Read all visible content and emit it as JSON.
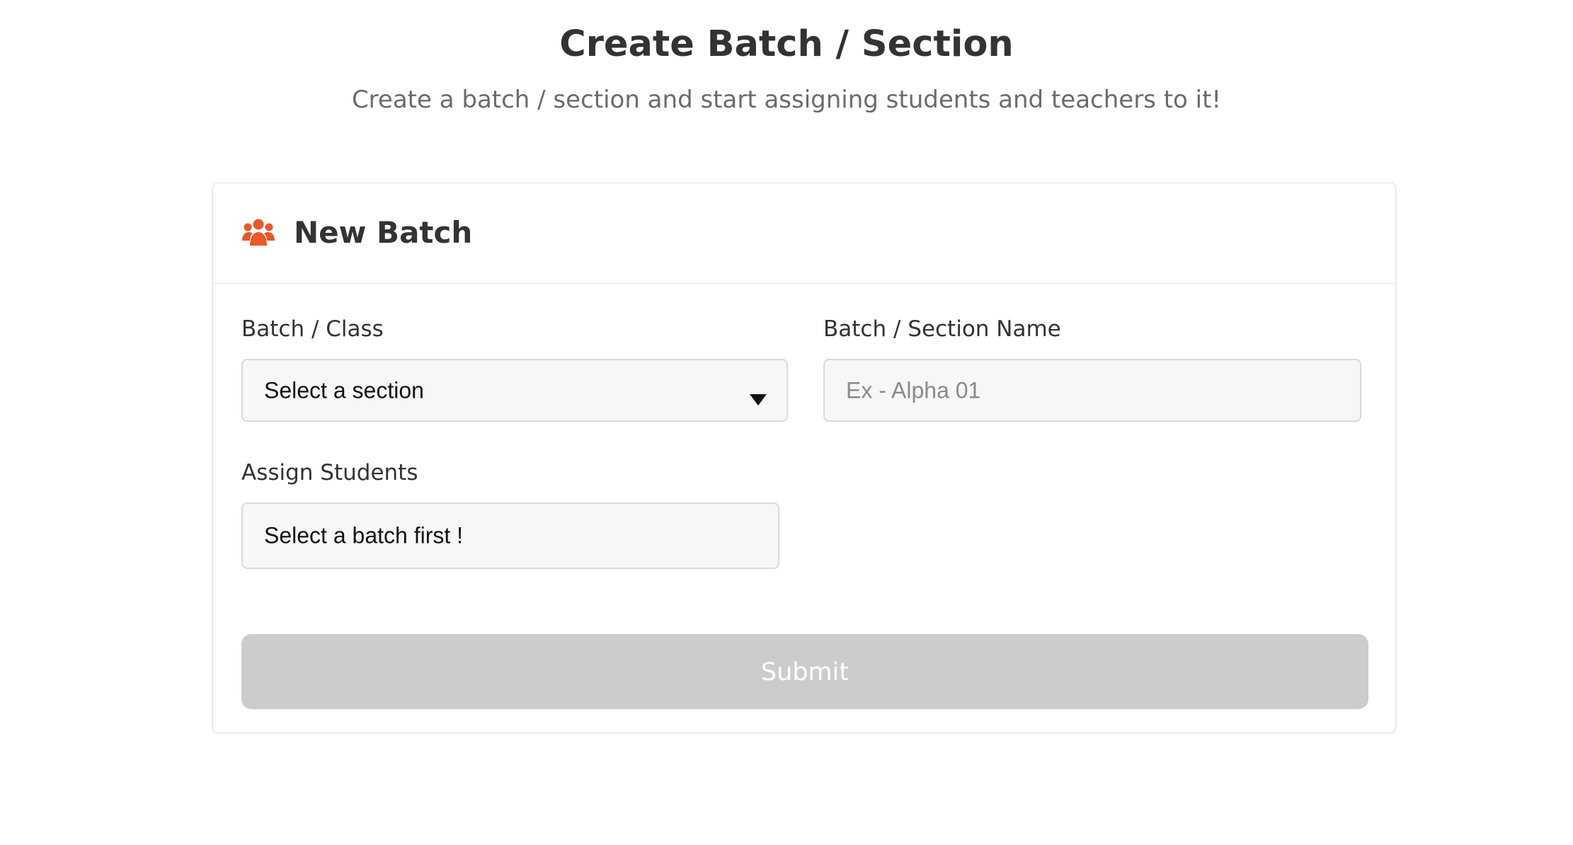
{
  "header": {
    "title": "Create Batch / Section",
    "subtitle": "Create a batch / section and start assigning students and teachers to it!"
  },
  "card": {
    "title": "New Batch",
    "icon": "users-group-icon",
    "accent_color": "#e8582b"
  },
  "form": {
    "batch_class": {
      "label": "Batch / Class",
      "selected": "Select a section",
      "icon": "caret-down-icon"
    },
    "section_name": {
      "label": "Batch / Section Name",
      "placeholder": "Ex - Alpha 01",
      "value": ""
    },
    "assign_students": {
      "label": "Assign Students",
      "value": "Select a batch first !"
    },
    "submit": {
      "label": "Submit",
      "state": "disabled",
      "color": "#cccccc"
    }
  }
}
